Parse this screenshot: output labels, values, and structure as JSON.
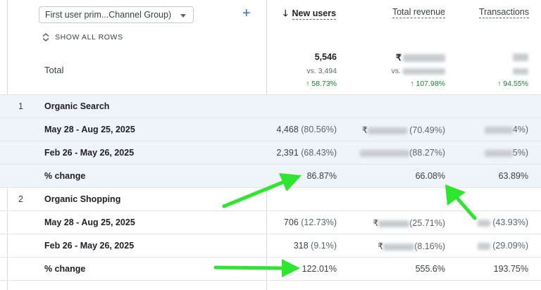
{
  "header": {
    "dimension_select": "First user prim...Channel Group)",
    "show_all_rows": "SHOW ALL ROWS",
    "total_label": "Total",
    "columns": [
      {
        "label": "New users",
        "sorted": "descending"
      },
      {
        "label": "Total revenue"
      },
      {
        "label": "Transactions"
      }
    ]
  },
  "totals": {
    "new_users": {
      "value": "5,546",
      "vs": "vs. 3,494",
      "change": "↑ 58.73%"
    },
    "revenue": {
      "value": "₹",
      "vs": "vs. ",
      "change": "↑ 107.98%"
    },
    "transactions": {
      "value": "",
      "vs": "",
      "change": "↑ 94.55%"
    }
  },
  "rows": [
    {
      "type": "group",
      "index": "1",
      "label": "Organic Search"
    },
    {
      "type": "period",
      "label": "May 28 - Aug 25, 2025",
      "new_users": "4,468",
      "new_users_pct": "(80.56%)",
      "revenue_prefix": "₹",
      "revenue_pct": "(70.49%)",
      "transactions_pct": "4%)"
    },
    {
      "type": "period",
      "label": "Feb 26 - May 26, 2025",
      "new_users": "2,391",
      "new_users_pct": "(68.43%)",
      "revenue_prefix": "",
      "revenue_pct": "(88.27%)",
      "transactions_pct": "5%)"
    },
    {
      "type": "change",
      "label": "% change",
      "new_users": "86.87%",
      "revenue": "66.08%",
      "transactions": "63.89%"
    },
    {
      "type": "group",
      "index": "2",
      "label": "Organic Shopping"
    },
    {
      "type": "period",
      "label": "May 28 - Aug 25, 2025",
      "new_users": "706",
      "new_users_pct": "(12.73%)",
      "revenue_prefix": "₹",
      "revenue_pct": "(25.71%)",
      "transactions_pct": "(43.93%)"
    },
    {
      "type": "period",
      "label": "Feb 26 - May 26, 2025",
      "new_users": "318",
      "new_users_pct": "(9.1%)",
      "revenue_prefix": "₹",
      "revenue_pct": "(8.16%)",
      "transactions_pct": "(29.09%)"
    },
    {
      "type": "change",
      "label": "% change",
      "new_users": "122.01%",
      "revenue": "555.6%",
      "transactions": "193.75%"
    }
  ],
  "colors": {
    "link_blue": "#1a73e8",
    "positive_green": "#188038",
    "row_shade": "#eef4f7",
    "arrow_green": "#2ee62e"
  },
  "icons": {
    "add": "plus-icon",
    "expand": "unfold-icon",
    "sort": "arrow-down-icon",
    "dropdown": "caret-down-icon"
  }
}
